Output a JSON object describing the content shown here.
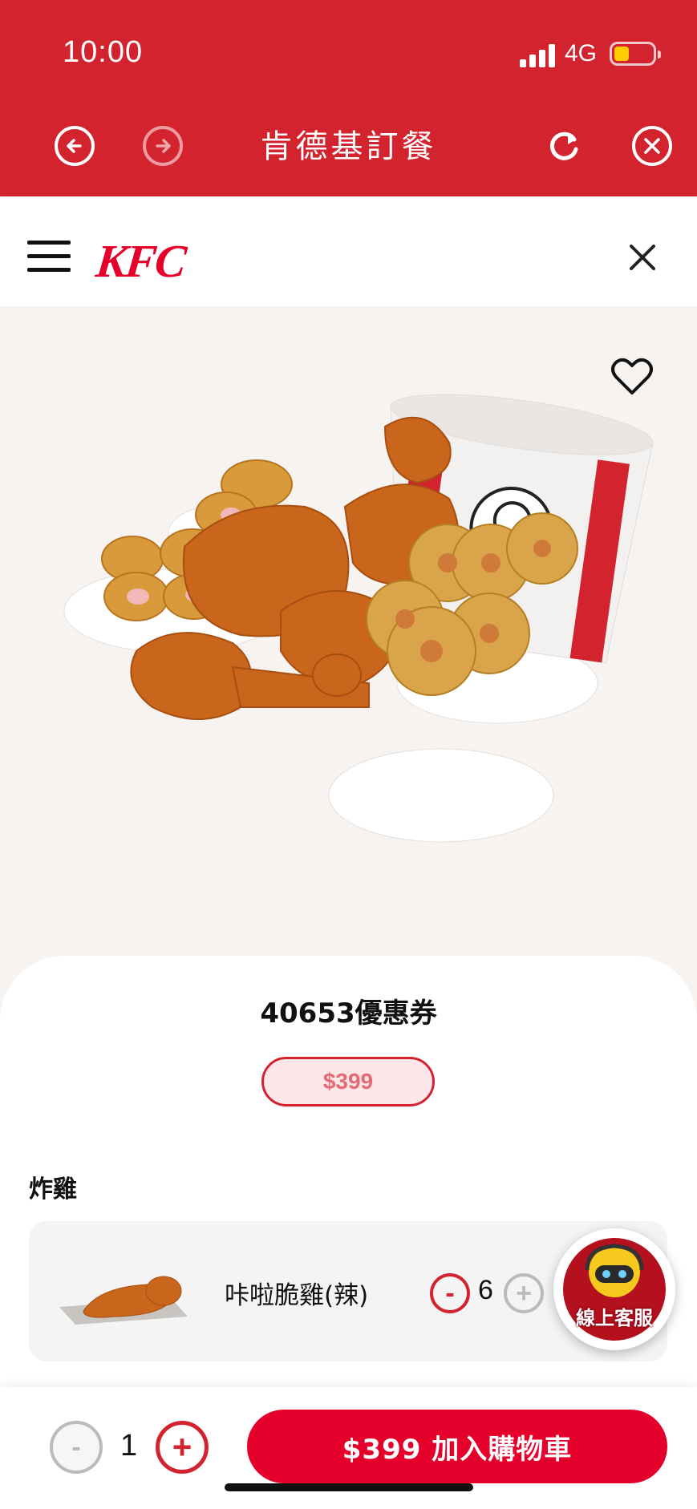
{
  "status_bar": {
    "time": "10:00",
    "network": "4G"
  },
  "browser": {
    "title": "肯德基訂餐"
  },
  "header": {
    "logo": "KFC"
  },
  "product": {
    "title": "40653優惠券",
    "price": "$399",
    "section_title": "炸雞",
    "items": [
      {
        "name": "咔啦脆雞(辣)",
        "quantity": "6",
        "minus_label": "-",
        "plus_label": "+"
      }
    ]
  },
  "support": {
    "label": "線上客服"
  },
  "footer": {
    "quantity": "1",
    "minus_label": "-",
    "plus_label": "+",
    "cart_button_label": "$399 加入購物車"
  },
  "colors": {
    "brand_red": "#d3232f",
    "kfc_red": "#e4002b"
  }
}
